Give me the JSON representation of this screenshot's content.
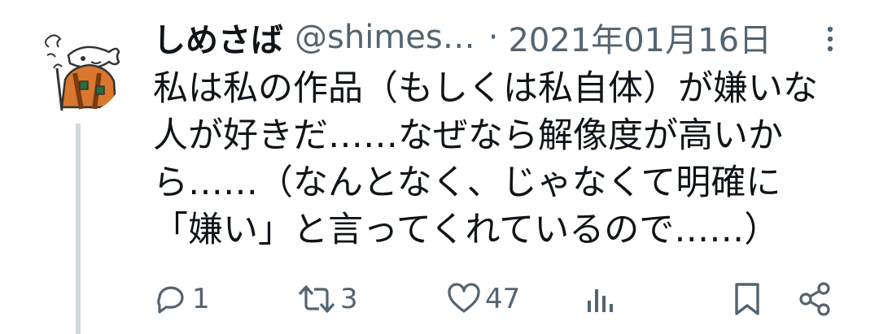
{
  "tweet": {
    "display_name": "しめさば",
    "handle": "@shimes…",
    "separator": "·",
    "date": "2021年01月16日",
    "lines": [
      "私は私の作品（もしくは私自体）が嫌いな",
      "人が好きだ……なぜなら解像度が高いか",
      "ら……（なんとなく、じゃなくて明確に",
      "「嫌い」と言ってくれているので……）"
    ]
  },
  "actions": {
    "reply_count": "1",
    "retweet_count": "3",
    "like_count": "47"
  },
  "icons": {
    "more": "more-vertical-icon",
    "reply": "reply-icon",
    "retweet": "retweet-icon",
    "like": "heart-icon",
    "views": "analytics-icon",
    "bookmark": "bookmark-icon",
    "share": "share-icon"
  },
  "colors": {
    "text": "#0f1419",
    "secondary": "#536471",
    "thread_line": "#cfd9de",
    "avatar_orange": "#d9772f"
  }
}
